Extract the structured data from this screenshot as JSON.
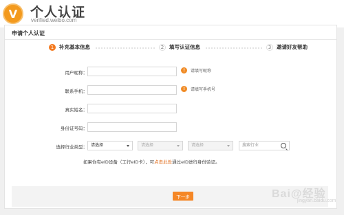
{
  "header": {
    "logo_letter": "V",
    "title": "个人认证",
    "subtitle": "verified.weibo.com"
  },
  "panel": {
    "title": "申请个人认证"
  },
  "steps": [
    {
      "num": "1",
      "label": "补充基本信息",
      "state": "active"
    },
    {
      "num": "2",
      "label": "填写认证信息",
      "state": "inactive"
    },
    {
      "num": "3",
      "label": "邀请好友帮助",
      "state": "inactive"
    }
  ],
  "form": {
    "nickname_label": "用户昵称：",
    "nickname_hint": "请填写昵称",
    "phone_label": "联系手机：",
    "phone_hint": "请填写手机号",
    "realname_label": "真实姓名：",
    "idnum_label": "身份证号码：",
    "industry_label": "选择行业类型：",
    "industry_select": "请选择",
    "sub_select_1": "请选择",
    "sub_select_2": "请选择",
    "search_placeholder": "搜索行业"
  },
  "note": {
    "prefix": "如果你有eID设备（工行eID卡），可",
    "link": "点击此处",
    "suffix": "通过eID进行身份验证。"
  },
  "footer": {
    "next_label": "下一步"
  },
  "watermark": {
    "text": "Bai@经验",
    "sub": "jingyan.baidu.com"
  },
  "colors": {
    "accent": "#f58726",
    "hint_icon": "#f08a24",
    "link": "#e06b1a"
  }
}
